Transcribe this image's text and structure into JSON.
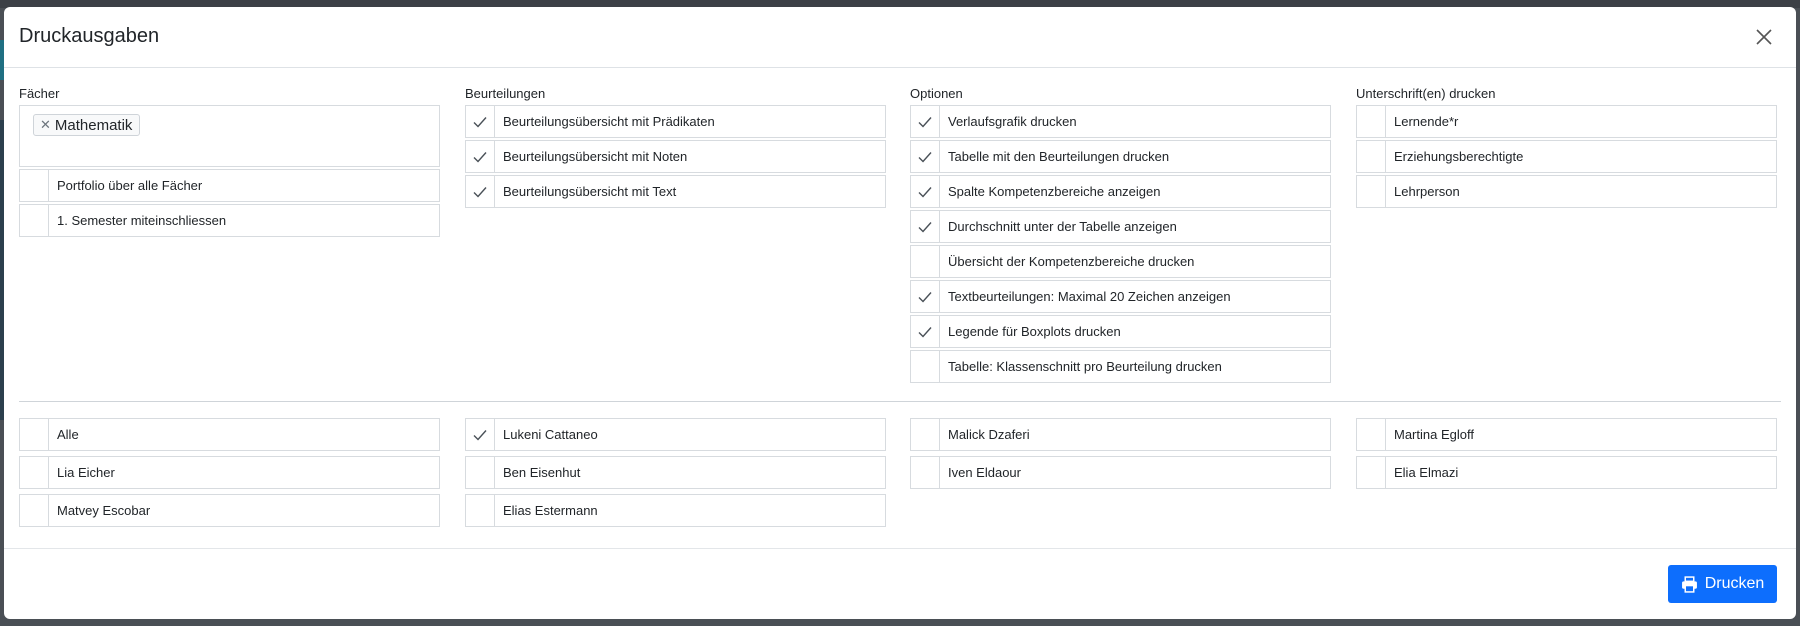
{
  "modal": {
    "title": "Druckausgaben"
  },
  "faecher": {
    "label": "Fächer",
    "selected_tag": "Mathematik",
    "options": [
      {
        "label": "Portfolio über alle Fächer",
        "checked": false
      },
      {
        "label": "1. Semester miteinschliessen",
        "checked": false
      }
    ]
  },
  "beurteilungen": {
    "label": "Beurteilungen",
    "options": [
      {
        "label": "Beurteilungsübersicht mit Prädikaten",
        "checked": true
      },
      {
        "label": "Beurteilungsübersicht mit Noten",
        "checked": true
      },
      {
        "label": "Beurteilungsübersicht mit Text",
        "checked": true
      }
    ]
  },
  "optionen": {
    "label": "Optionen",
    "options": [
      {
        "label": "Verlaufsgrafik drucken",
        "checked": true
      },
      {
        "label": "Tabelle mit den Beurteilungen drucken",
        "checked": true
      },
      {
        "label": "Spalte Kompetenzbereiche anzeigen",
        "checked": true
      },
      {
        "label": "Durchschnitt unter der Tabelle anzeigen",
        "checked": true
      },
      {
        "label": "Übersicht der Kompetenzbereiche drucken",
        "checked": false
      },
      {
        "label": "Textbeurteilungen: Maximal 20 Zeichen anzeigen",
        "checked": true
      },
      {
        "label": "Legende für Boxplots drucken",
        "checked": true
      },
      {
        "label": "Tabelle: Klassenschnitt pro Beurteilung drucken",
        "checked": false
      }
    ]
  },
  "unterschriften": {
    "label": "Unterschrift(en) drucken",
    "options": [
      {
        "label": "Lernende*r",
        "checked": false
      },
      {
        "label": "Erziehungsberechtigte",
        "checked": false
      },
      {
        "label": "Lehrperson",
        "checked": false
      }
    ]
  },
  "students": [
    {
      "label": "Alle",
      "checked": false
    },
    {
      "label": "Lukeni Cattaneo",
      "checked": true
    },
    {
      "label": "Malick Dzaferi",
      "checked": false
    },
    {
      "label": "Martina Egloff",
      "checked": false
    },
    {
      "label": "Lia Eicher",
      "checked": false
    },
    {
      "label": "Ben Eisenhut",
      "checked": false
    },
    {
      "label": "Iven Eldaour",
      "checked": false
    },
    {
      "label": "Elia Elmazi",
      "checked": false
    },
    {
      "label": "Matvey Escobar",
      "checked": false
    },
    {
      "label": "Elias Estermann",
      "checked": false
    }
  ],
  "footer": {
    "print_label": "Drucken"
  },
  "colors": {
    "primary": "#0d6efd",
    "border": "#d7dbdf",
    "check": "#495057"
  },
  "icons": {
    "close": "close-icon",
    "check": "check-icon",
    "print": "printer-icon",
    "tag_remove": "remove-tag-icon"
  }
}
